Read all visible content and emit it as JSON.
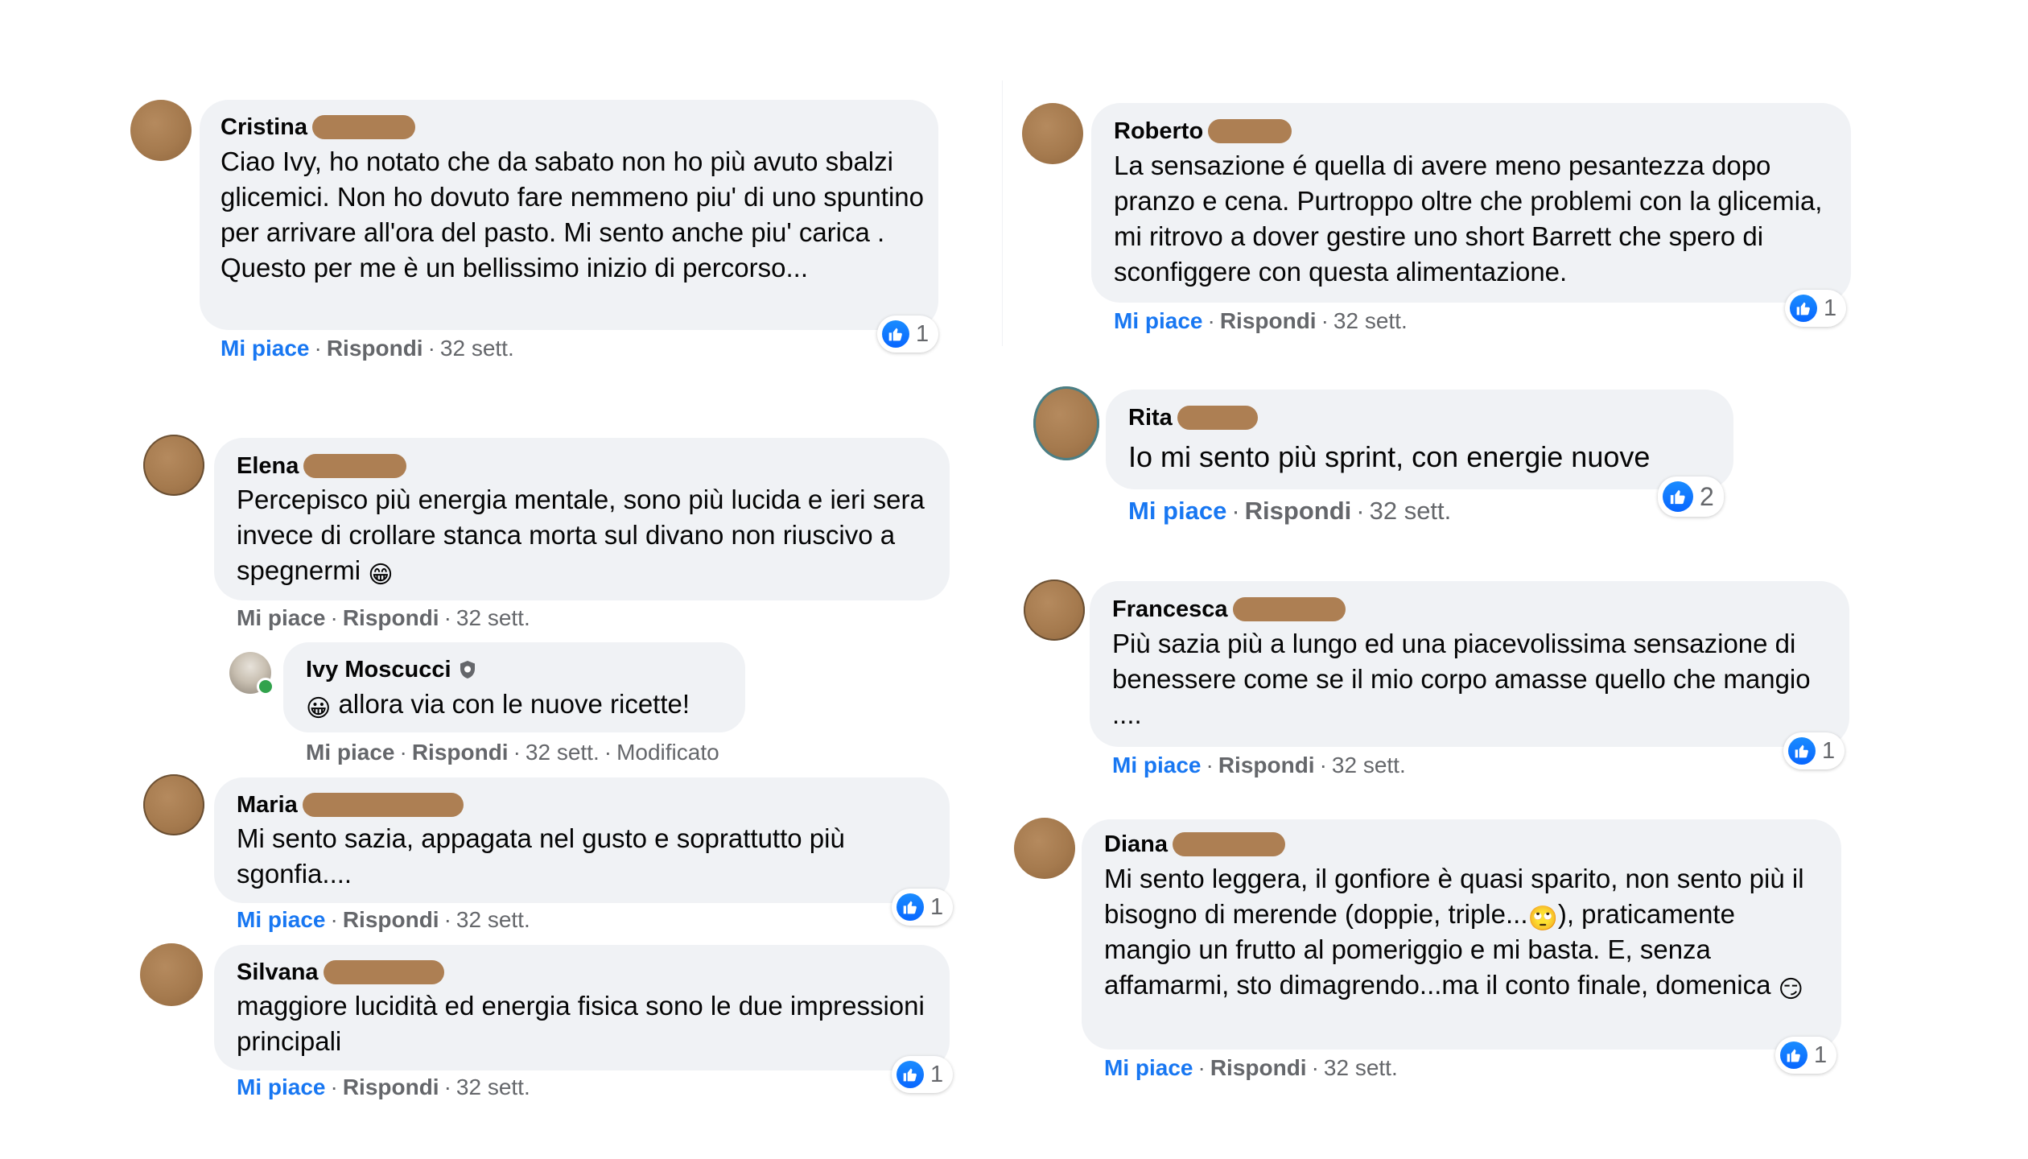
{
  "left_comments": {
    "cristina": {
      "name": "Cristina",
      "text": "Ciao Ivy, ho notato che da sabato non ho più avuto sbalzi glicemici. Non ho dovuto fare nemmeno piu' di uno spuntino per arrivare all'ora del pasto. Mi sento anche piu' carica . Questo per me è un bellissimo inizio di percorso...",
      "like_label": "Mi piace",
      "reply_label": "Rispondi",
      "time": "32 sett.",
      "reactions": "1"
    },
    "elena": {
      "name": "Elena",
      "text": "Percepisco più energia mentale, sono più lucida e ieri sera invece di crollare stanca morta sul divano non riuscivo a spegnermi",
      "emoji": "😁",
      "like_label": "Mi piace",
      "reply_label": "Rispondi",
      "time": "32 sett."
    },
    "ivy_reply": {
      "name": "Ivy Moscucci",
      "badge_icon": "author-shield-icon",
      "emoji": "😀",
      "text": "allora via con le nuove ricette!",
      "like_label": "Mi piace",
      "reply_label": "Rispondi",
      "time": "32 sett.",
      "edited": "Modificato"
    },
    "maria": {
      "name": "Maria",
      "text": "Mi sento sazia, appagata nel gusto e soprattutto più sgonfia....",
      "like_label": "Mi piace",
      "reply_label": "Rispondi",
      "time": "32 sett.",
      "reactions": "1"
    },
    "silvana": {
      "name": "Silvana",
      "text": "maggiore lucidità ed energia fisica sono le due impressioni principali",
      "like_label": "Mi piace",
      "reply_label": "Rispondi",
      "time": "32 sett.",
      "reactions": "1"
    }
  },
  "right_comments": {
    "roberto": {
      "name": "Roberto",
      "text": "La sensazione é quella di avere meno pesantezza dopo pranzo e cena. Purtroppo oltre che problemi con la glicemia, mi ritrovo a dover gestire uno short Barrett che spero di sconfiggere con questa alimentazione.",
      "like_label": "Mi piace",
      "reply_label": "Rispondi",
      "time": "32 sett.",
      "reactions": "1"
    },
    "rita": {
      "name": "Rita",
      "text": "Io mi sento più sprint, con energie nuove",
      "like_label": "Mi piace",
      "reply_label": "Rispondi",
      "time": "32 sett.",
      "reactions": "2"
    },
    "francesca": {
      "name": "Francesca",
      "text": "Più sazia più a lungo ed una piacevolissima sensazione di benessere come se il mio corpo amasse quello che mangio ....",
      "like_label": "Mi piace",
      "reply_label": "Rispondi",
      "time": "32 sett.",
      "reactions": "1"
    },
    "diana": {
      "name": "Diana",
      "text_a": "Mi sento leggera, il gonfiore è quasi sparito, non sento più il bisogno di merende (doppie, triple...",
      "emoji_a": "🙄",
      "text_b": "), praticamente mangio un frutto al pomeriggio e mi basta. E, senza affamarmi, sto dimagrendo...ma il conto finale, domenica",
      "emoji_b": "😏",
      "like_label": "Mi piace",
      "reply_label": "Rispondi",
      "time": "32 sett.",
      "reactions": "1"
    }
  },
  "colors": {
    "bubble": "#f0f2f5",
    "like_blue": "#1877f2",
    "meta_gray": "#65676b",
    "redaction": "#a9784a"
  }
}
